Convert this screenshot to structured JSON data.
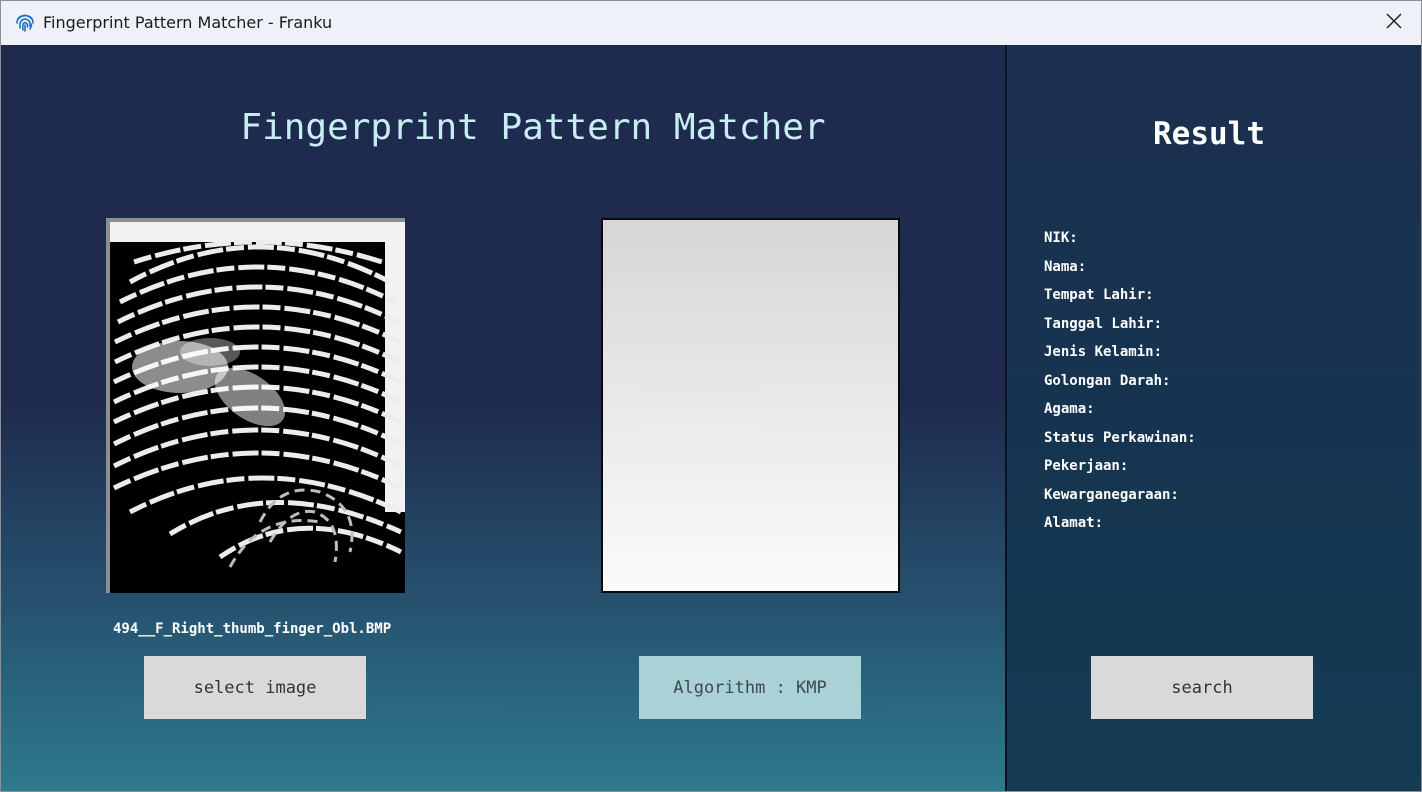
{
  "window": {
    "title": "Fingerprint Pattern Matcher - Franku",
    "app_icon": "fingerprint-icon",
    "close_icon": "close-icon"
  },
  "main": {
    "title": "Fingerprint Pattern Matcher",
    "input_image_filename": "494__F_Right_thumb_finger_Obl.BMP",
    "select_button_label": "select image",
    "algorithm_button_label": "Algorithm : KMP"
  },
  "result": {
    "title": "Result",
    "fields": [
      "NIK:",
      "Nama:",
      "Tempat Lahir:",
      "Tanggal Lahir:",
      "Jenis Kelamin:",
      "Golongan Darah:",
      "Agama:",
      "Status Perkawinan:",
      "Pekerjaan:",
      "Kewarganegaraan:",
      "Alamat:"
    ],
    "search_button_label": "search"
  },
  "colors": {
    "title_text": "#c6eef2",
    "button_gray": "#d9d9d9",
    "button_teal": "#a9d1d6",
    "panel_dark": "#1f2b4e",
    "panel_teal": "#2e7a8d"
  }
}
